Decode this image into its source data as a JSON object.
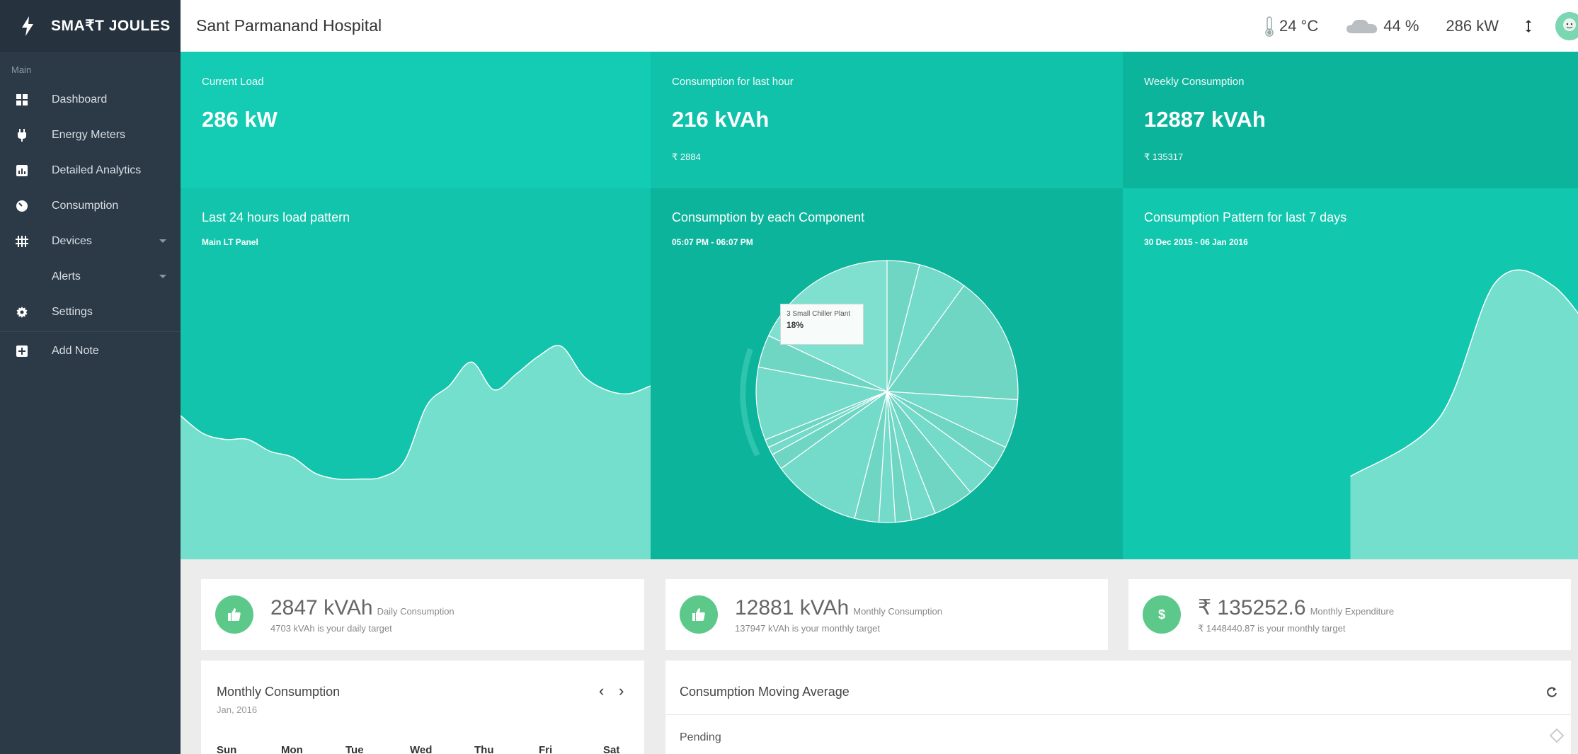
{
  "brand": {
    "name": "SMA₹T JOULES"
  },
  "sidebar": {
    "section_label": "Main",
    "items": [
      {
        "label": "Dashboard",
        "icon": "dashboard-icon"
      },
      {
        "label": "Energy Meters",
        "icon": "plug-icon"
      },
      {
        "label": "Detailed Analytics",
        "icon": "analytics-icon"
      },
      {
        "label": "Consumption",
        "icon": "gauge-icon"
      },
      {
        "label": "Devices",
        "icon": "devices-icon"
      },
      {
        "label": "Alerts",
        "icon": ""
      },
      {
        "label": "Settings",
        "icon": "gear-icon"
      },
      {
        "label": "Add Note",
        "icon": "plus-icon"
      }
    ]
  },
  "topbar": {
    "hospital": "Sant Parmanand Hospital",
    "temperature": "24 °C",
    "humidity": "44 %",
    "load": "286 kW",
    "sort_icon": "updown-icon"
  },
  "tiles": {
    "current_load": {
      "label": "Current Load",
      "value": "286 kW"
    },
    "last_hour": {
      "label": "Consumption for last hour",
      "value": "216 kVAh",
      "sub": "₹ 2884"
    },
    "weekly": {
      "label": "Weekly Consumption",
      "value": "12887 kVAh",
      "sub": "₹ 135317"
    }
  },
  "charts": {
    "load_pattern": {
      "title": "Last 24 hours load pattern",
      "subtitle": "Main LT Panel"
    },
    "component": {
      "title": "Consumption by each Component",
      "subtitle": "05:07 PM - 06:07 PM",
      "tooltip_label": "3 Small Chiller Plant",
      "tooltip_value": "18%"
    },
    "weekly_pattern": {
      "title": "Consumption Pattern for last 7 days",
      "subtitle": "30 Dec 2015 - 06 Jan 2016"
    }
  },
  "chart_data": [
    {
      "type": "area",
      "title": "Last 24 hours load pattern",
      "values": [
        45,
        36,
        33,
        33,
        27,
        24,
        16,
        13,
        13,
        14,
        22,
        50,
        60,
        72,
        58,
        66,
        75,
        80,
        65,
        58,
        56,
        60
      ]
    },
    {
      "type": "pie",
      "title": "Consumption by each Component",
      "slices": [
        {
          "label": "3 Small Chiller Plant",
          "value": 18
        },
        {
          "label": "",
          "value": 4
        },
        {
          "label": "",
          "value": 6
        },
        {
          "label": "",
          "value": 16
        },
        {
          "label": "",
          "value": 6
        },
        {
          "label": "",
          "value": 3
        },
        {
          "label": "",
          "value": 4
        },
        {
          "label": "",
          "value": 5
        },
        {
          "label": "",
          "value": 3
        },
        {
          "label": "",
          "value": 2
        },
        {
          "label": "",
          "value": 2
        },
        {
          "label": "",
          "value": 3
        },
        {
          "label": "",
          "value": 11
        },
        {
          "label": "",
          "value": 2
        },
        {
          "label": "",
          "value": 1
        },
        {
          "label": "",
          "value": 1
        },
        {
          "label": "",
          "value": 9
        },
        {
          "label": "",
          "value": 4
        }
      ]
    },
    {
      "type": "area",
      "title": "Consumption Pattern for last 7 days",
      "values": [
        0,
        0,
        0,
        0,
        0,
        30,
        100,
        98,
        60
      ]
    }
  ],
  "kpis": [
    {
      "value": "2847 kVAh",
      "label": "Daily Consumption",
      "target": "4703 kVAh is your daily target",
      "icon": "thumbs-up-icon"
    },
    {
      "value": "12881 kVAh",
      "label": "Monthly Consumption",
      "target": "137947 kVAh is your monthly target",
      "icon": "thumbs-up-icon"
    },
    {
      "value": "₹ 135252.6",
      "label": "Monthly Expenditure",
      "target": "₹ 1448440.87 is your monthly target",
      "icon": "dollar-icon"
    }
  ],
  "monthly": {
    "title": "Monthly Consumption",
    "month": "Jan, 2016",
    "prev": "‹",
    "next": "›",
    "weekdays": [
      "Sun",
      "Mon",
      "Tue",
      "Wed",
      "Thu",
      "Fri",
      "Sat"
    ]
  },
  "moving_average": {
    "title": "Consumption Moving Average",
    "status": "Pending"
  },
  "colors": {
    "sidebar": "#2c3a47",
    "tile_light": "#13ccb3",
    "tile_mid": "#11c2aa",
    "tile_dark": "#0db49c",
    "area_fill": "#74dfcd",
    "kpi_green": "#5cc98b"
  }
}
